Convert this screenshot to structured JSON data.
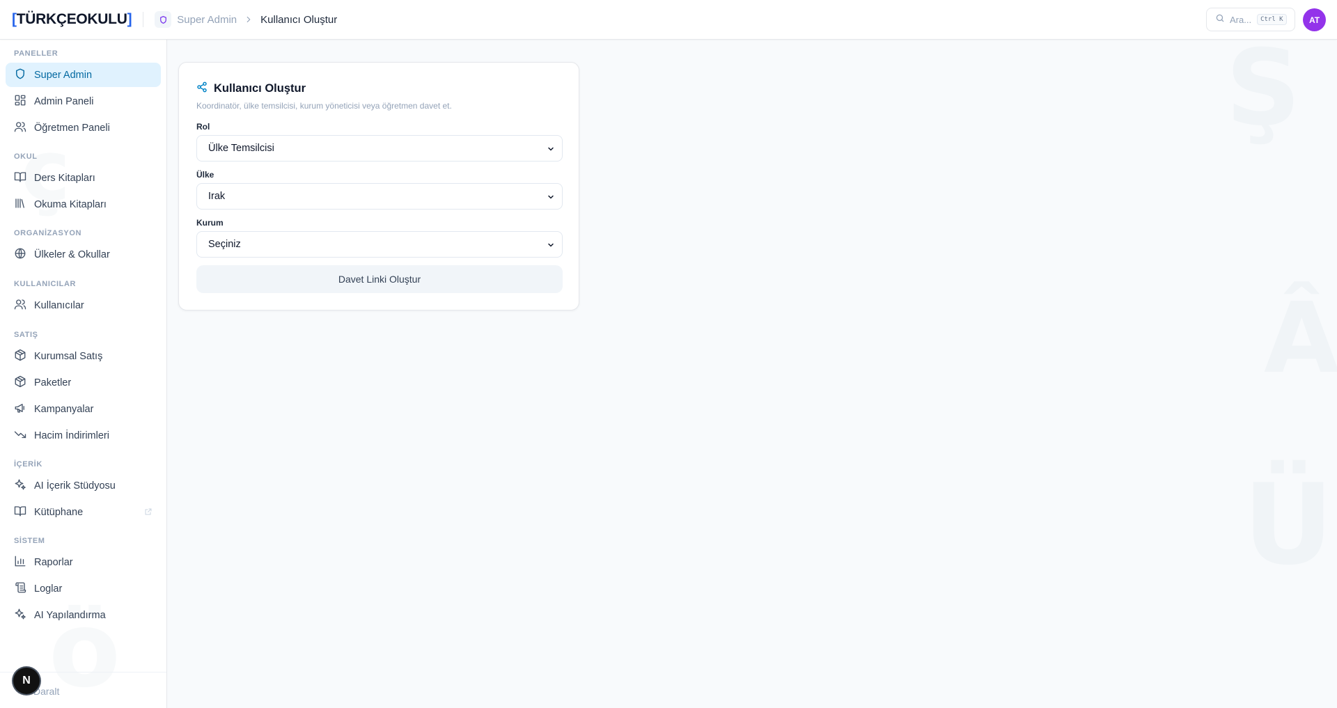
{
  "brand": {
    "logo_open": "[",
    "logo_text": "TÜRKÇEOKULU",
    "logo_close": "]"
  },
  "breadcrumb": {
    "parent": "Super Admin",
    "current": "Kullanıcı Oluştur"
  },
  "search": {
    "placeholder": "Ara...",
    "shortcut": "Ctrl K"
  },
  "user": {
    "initials": "AT"
  },
  "sidebar": {
    "sections": [
      {
        "title": "PANELLER",
        "items": [
          {
            "label": "Super Admin",
            "icon": "shield-icon",
            "active": true
          },
          {
            "label": "Admin Paneli",
            "icon": "dashboard-icon"
          },
          {
            "label": "Öğretmen Paneli",
            "icon": "users-icon"
          }
        ]
      },
      {
        "title": "OKUL",
        "items": [
          {
            "label": "Ders Kitapları",
            "icon": "book-open-icon"
          },
          {
            "label": "Okuma Kitapları",
            "icon": "library-icon"
          }
        ]
      },
      {
        "title": "ORGANİZASYON",
        "items": [
          {
            "label": "Ülkeler & Okullar",
            "icon": "globe-icon"
          }
        ]
      },
      {
        "title": "KULLANICILAR",
        "items": [
          {
            "label": "Kullanıcılar",
            "icon": "users-icon"
          }
        ]
      },
      {
        "title": "SATIŞ",
        "items": [
          {
            "label": "Kurumsal Satış",
            "icon": "package-icon"
          },
          {
            "label": "Paketler",
            "icon": "package-icon"
          },
          {
            "label": "Kampanyalar",
            "icon": "megaphone-icon"
          },
          {
            "label": "Hacim İndirimleri",
            "icon": "trending-down-icon"
          }
        ]
      },
      {
        "title": "İÇERİK",
        "items": [
          {
            "label": "AI İçerik Stüdyosu",
            "icon": "sparkles-icon"
          },
          {
            "label": "Kütüphane",
            "icon": "book-open-icon",
            "external": true
          }
        ]
      },
      {
        "title": "SİSTEM",
        "items": [
          {
            "label": "Raporlar",
            "icon": "bar-chart-icon"
          },
          {
            "label": "Loglar",
            "icon": "scroll-icon"
          },
          {
            "label": "AI Yapılandırma",
            "icon": "sparkles-icon"
          }
        ]
      }
    ],
    "collapse_label": "Daralt",
    "dev_badge": "N"
  },
  "form": {
    "title": "Kullanıcı Oluştur",
    "description": "Koordinatör, ülke temsilcisi, kurum yöneticisi veya öğretmen davet et.",
    "fields": [
      {
        "label": "Rol",
        "value": "Ülke Temsilcisi"
      },
      {
        "label": "Ülke",
        "value": "Irak"
      },
      {
        "label": "Kurum",
        "value": "Seçiniz"
      }
    ],
    "submit_label": "Davet Linki Oluştur"
  },
  "watermarks": [
    "Ş",
    "Â",
    "Ü",
    "ö",
    "ç"
  ],
  "colors": {
    "accent": "#0369a1",
    "brand": "#2563eb",
    "avatar": "#9333ea",
    "active_bg": "#e0f2fe"
  }
}
